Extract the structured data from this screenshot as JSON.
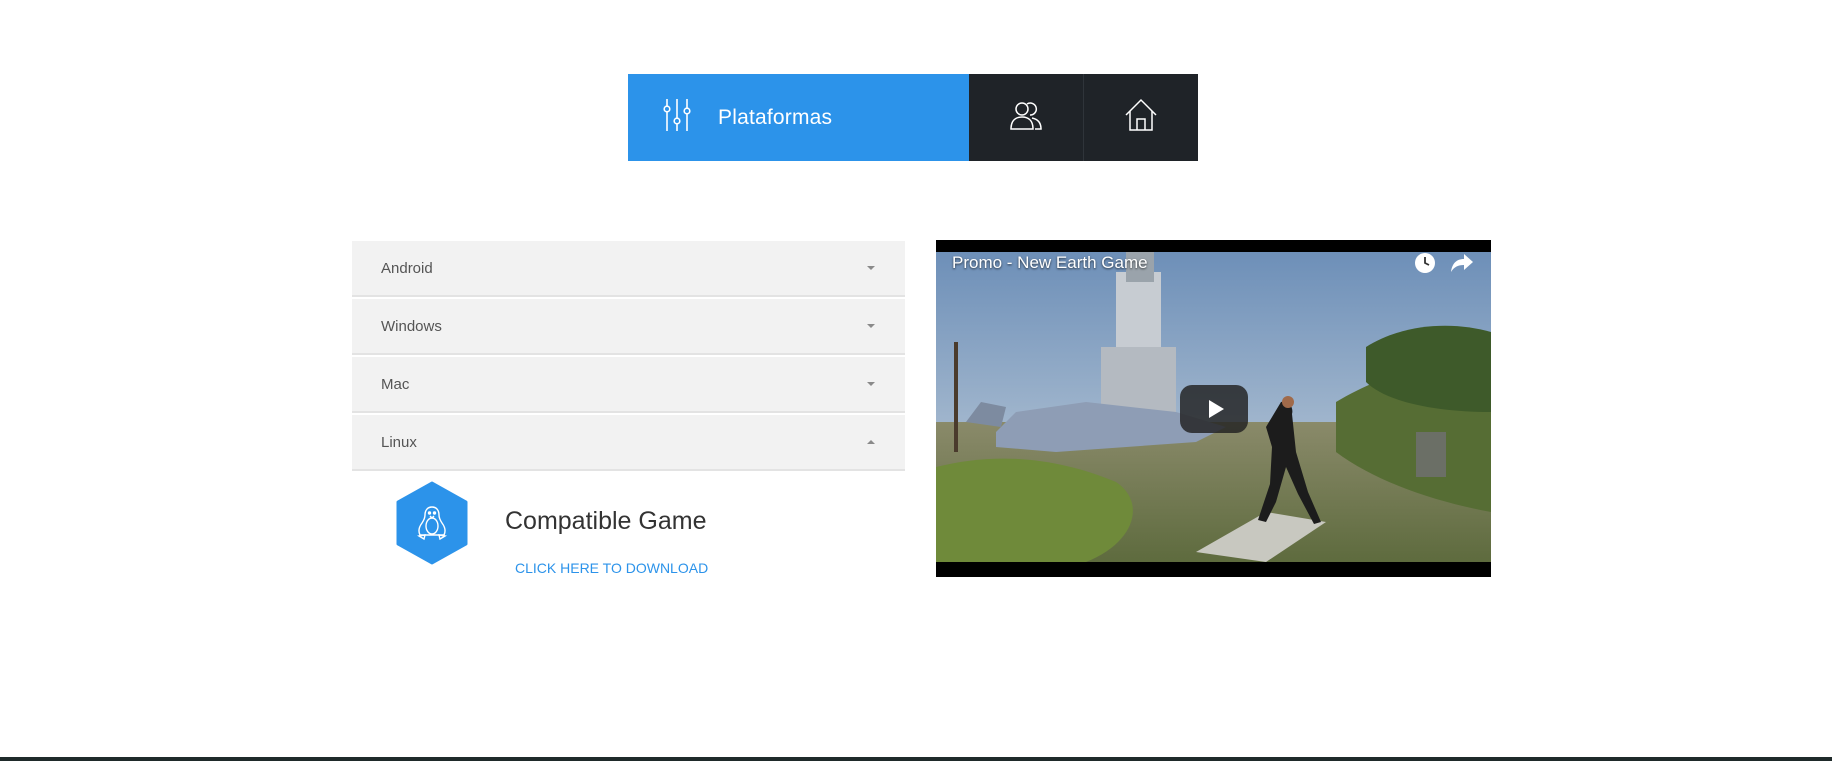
{
  "nav": {
    "active_label": "Plataformas",
    "icons": [
      "sliders-icon",
      "users-icon",
      "home-icon"
    ]
  },
  "accordion": {
    "items": [
      {
        "label": "Android",
        "state": "collapsed"
      },
      {
        "label": "Windows",
        "state": "collapsed"
      },
      {
        "label": "Mac",
        "state": "collapsed"
      },
      {
        "label": "Linux",
        "state": "expanded"
      }
    ],
    "panel": {
      "icon": "linux-penguin-icon",
      "title": "Compatible Game",
      "link": "CLICK HERE TO DOWNLOAD"
    }
  },
  "video": {
    "title": "Promo - New Earth Game",
    "icons": [
      "watch-later-icon",
      "share-icon",
      "play-icon"
    ]
  },
  "colors": {
    "accent": "#2c93ea",
    "nav_dark": "#1f2328",
    "accordion_bg": "#f2f2f2",
    "footer": "#1f2a2a"
  }
}
